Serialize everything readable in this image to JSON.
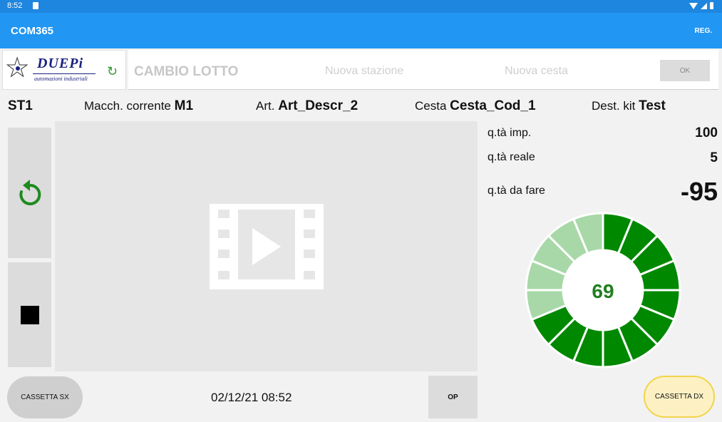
{
  "status_bar": {
    "time": "8:52"
  },
  "app_bar": {
    "title": "COM365",
    "reg_label": "REG."
  },
  "logo": {
    "brand": "DUEPi",
    "subtitle": "automazioni industriali"
  },
  "lotto_panel": {
    "title": "CAMBIO LOTTO",
    "nuova_stazione": "Nuova stazione",
    "nuova_cesta": "Nuova cesta",
    "ok_label": "OK"
  },
  "info": {
    "station": "ST1",
    "macch_label": "Macch. corrente",
    "macch_value": "M1",
    "art_label": "Art.",
    "art_value": "Art_Descr_2",
    "cesta_label": "Cesta",
    "cesta_value": "Cesta_Cod_1",
    "dest_label": "Dest. kit",
    "dest_value": "Test"
  },
  "quantities": {
    "imp_label": "q.tà imp.",
    "imp_value": "100",
    "reale_label": "q.tà reale",
    "reale_value": "5",
    "dafare_label": "q.tà da fare",
    "dafare_value": "-95"
  },
  "gauge": {
    "value": "69",
    "segments_total": 16,
    "segments_filled": 11,
    "color_filled": "#008800",
    "color_empty": "#a8d8a8"
  },
  "bottom": {
    "cassetta_sx": "CASSETTA SX",
    "datetime": "02/12/21 08:52",
    "op": "OP",
    "cassetta_dx": "CASSETTA DX"
  },
  "colors": {
    "app_bar": "#2196f3",
    "status_bar": "#1f86df",
    "accent_green": "#2e9b2e",
    "cassetta_dx_border": "#f2d44a"
  }
}
